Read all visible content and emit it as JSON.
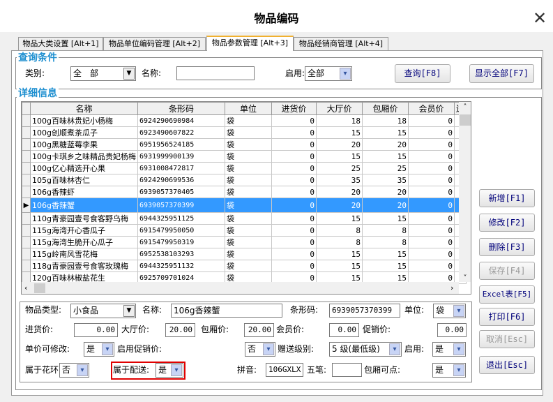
{
  "window": {
    "title": "物品编码",
    "close_icon": "close-icon"
  },
  "tabs": [
    {
      "label": "物品大类设置 [Alt+1]"
    },
    {
      "label": "物品单位编码管理 [Alt+2]"
    },
    {
      "label": "物品参数管理 [Alt+3]",
      "active": true
    },
    {
      "label": "物品经销商管理 [Alt+4]"
    }
  ],
  "query": {
    "legend": "查询条件",
    "category_label": "类别:",
    "category_value": "全　部",
    "name_label": "名称:",
    "name_value": "",
    "enabled_label": "启用:",
    "enabled_value": "全部",
    "search_button": "查询[F8]",
    "show_all_button": "显示全部[F7]"
  },
  "details_legend": "详细信息",
  "grid": {
    "columns": [
      "名称",
      "条形码",
      "单位",
      "进货价",
      "大厅价",
      "包厢价",
      "会员价",
      "送"
    ],
    "rows": [
      [
        "100g百味林贵妃小杨梅",
        "6924290690984",
        "袋",
        "0",
        "18",
        "18",
        "0"
      ],
      [
        "100g创顺煮茶瓜子",
        "6923490607822",
        "袋",
        "0",
        "15",
        "15",
        "0"
      ],
      [
        "100g黑糖蓝莓李果",
        "6951956524185",
        "袋",
        "0",
        "20",
        "20",
        "0"
      ],
      [
        "100g卡琪乡之味精品贵妃杨梅",
        "6931999900139",
        "袋",
        "0",
        "15",
        "15",
        "0"
      ],
      [
        "100g亿心精选开心果",
        "6931008472817",
        "袋",
        "0",
        "25",
        "25",
        "0"
      ],
      [
        "105g百味林杏仁",
        "6924290699536",
        "袋",
        "0",
        "35",
        "35",
        "0"
      ],
      [
        "106g香辣虾",
        "6939057370405",
        "袋",
        "0",
        "20",
        "20",
        "0"
      ],
      [
        "106g香辣蟹",
        "6939057370399",
        "袋",
        "0",
        "20",
        "20",
        "0"
      ],
      [
        "110g青豪园壹号食客野乌梅",
        "6944325951125",
        "袋",
        "0",
        "15",
        "15",
        "0"
      ],
      [
        "115g海湾开心香瓜子",
        "6915479950050",
        "袋",
        "0",
        "8",
        "8",
        "0"
      ],
      [
        "115g海湾生脆开心瓜子",
        "6915479950319",
        "袋",
        "0",
        "8",
        "8",
        "0"
      ],
      [
        "115g岭南风雪花梅",
        "6952538103293",
        "袋",
        "0",
        "15",
        "15",
        "0"
      ],
      [
        "118g青豪园壹号食客玫瑰梅",
        "6944325951132",
        "袋",
        "0",
        "15",
        "15",
        "0"
      ],
      [
        "120g百味林椒盐花生",
        "6925709701024",
        "袋",
        "0",
        "15",
        "15",
        "0"
      ]
    ],
    "selected_index": 7
  },
  "form": {
    "type_label": "物品类型:",
    "type_value": "小食品",
    "name_label": "名称:",
    "name_value": "106g香辣蟹",
    "barcode_label": "条形码:",
    "barcode_value": "6939057370399",
    "unit_label": "单位:",
    "unit_value": "袋",
    "purchase_label": "进货价:",
    "purchase_value": "0.00",
    "hall_label": "大厅价:",
    "hall_value": "20.00",
    "room_label": "包厢价:",
    "room_value": "20.00",
    "member_label": "会员价:",
    "member_value": "0.00",
    "promo_label": "促销价:",
    "promo_value": "0.00",
    "editable_label": "单价可修改:",
    "editable_value": "是",
    "promo_enable_label": "启用促销价:",
    "promo_enable_value": "否",
    "gift_label": "赠送级别:",
    "gift_value": "5 级(最低级)",
    "enabled_label": "启用:",
    "enabled_value": "是",
    "wreath_label": "属于花环:",
    "wreath_value": "否",
    "delivery_label": "属于配送:",
    "delivery_value": "是",
    "pinyin_label": "拼音:",
    "pinyin_value": "106GXLX",
    "wubi_label": "五笔:",
    "wubi_value": "",
    "room_order_label": "包厢可点:",
    "room_order_value": "是",
    "highlight_color": "#e00000"
  },
  "buttons": {
    "add": "新增[F1]",
    "edit": "修改[F2]",
    "delete": "删除[F3]",
    "save": "保存[F4]",
    "excel": "Excel表[F5]",
    "print": "打印[F6]",
    "cancel": "取消[Esc]",
    "exit": "退出[Esc]"
  }
}
